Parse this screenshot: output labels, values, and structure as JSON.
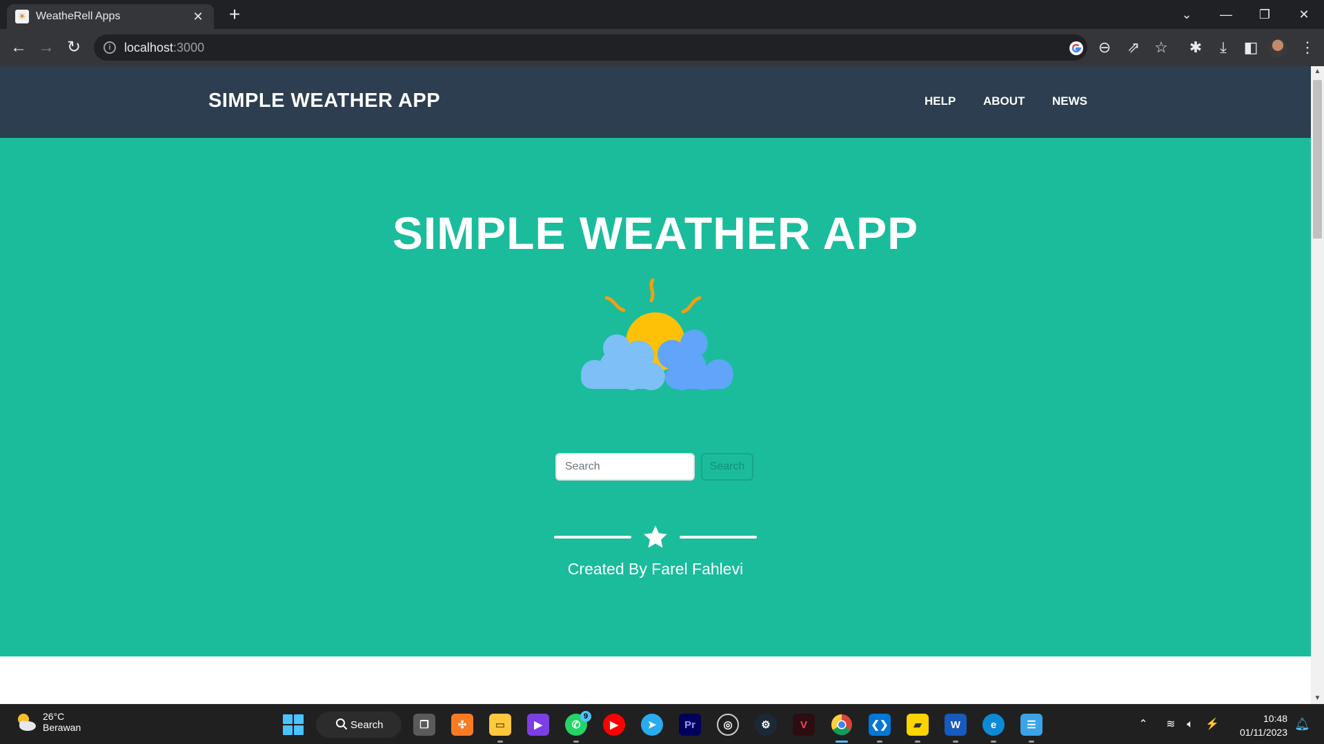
{
  "browser": {
    "tab_title": "WeatheRell Apps",
    "tab_close": "✕",
    "new_tab": "+",
    "url_host": "localhost",
    "url_port": ":3000",
    "controls": {
      "list": "⌄",
      "minimize": "—",
      "restore": "❐",
      "close": "✕"
    }
  },
  "site": {
    "brand": "SIMPLE WEATHER APP",
    "nav": [
      "HELP",
      "ABOUT",
      "NEWS"
    ],
    "hero_title": "SIMPLE WEATHER APP",
    "search": {
      "placeholder": "Search",
      "button_label": "Search"
    },
    "credit": "Created By Farel Fahlevi"
  },
  "taskbar": {
    "weather_temp": "26°C",
    "weather_condition": "Berawan",
    "search_label": "Search",
    "whatsapp_badge": "9",
    "time": "10:48",
    "date": "01/11/2023",
    "apps": [
      "task-view",
      "xampp",
      "file-explorer",
      "visual-studio",
      "whatsapp",
      "youtube-music",
      "telegram",
      "premiere-pro",
      "obs-studio",
      "steam",
      "valorant",
      "chrome",
      "vscode",
      "sticky-notes",
      "word",
      "edge",
      "notepad"
    ]
  },
  "colors": {
    "nav_bg": "#2c3e50",
    "masthead_bg": "#1abc9c",
    "sun": "#ffc107",
    "sun_rays": "#f59e0b",
    "cloud_light": "#7dbff6",
    "cloud_dark": "#60a5fa"
  }
}
